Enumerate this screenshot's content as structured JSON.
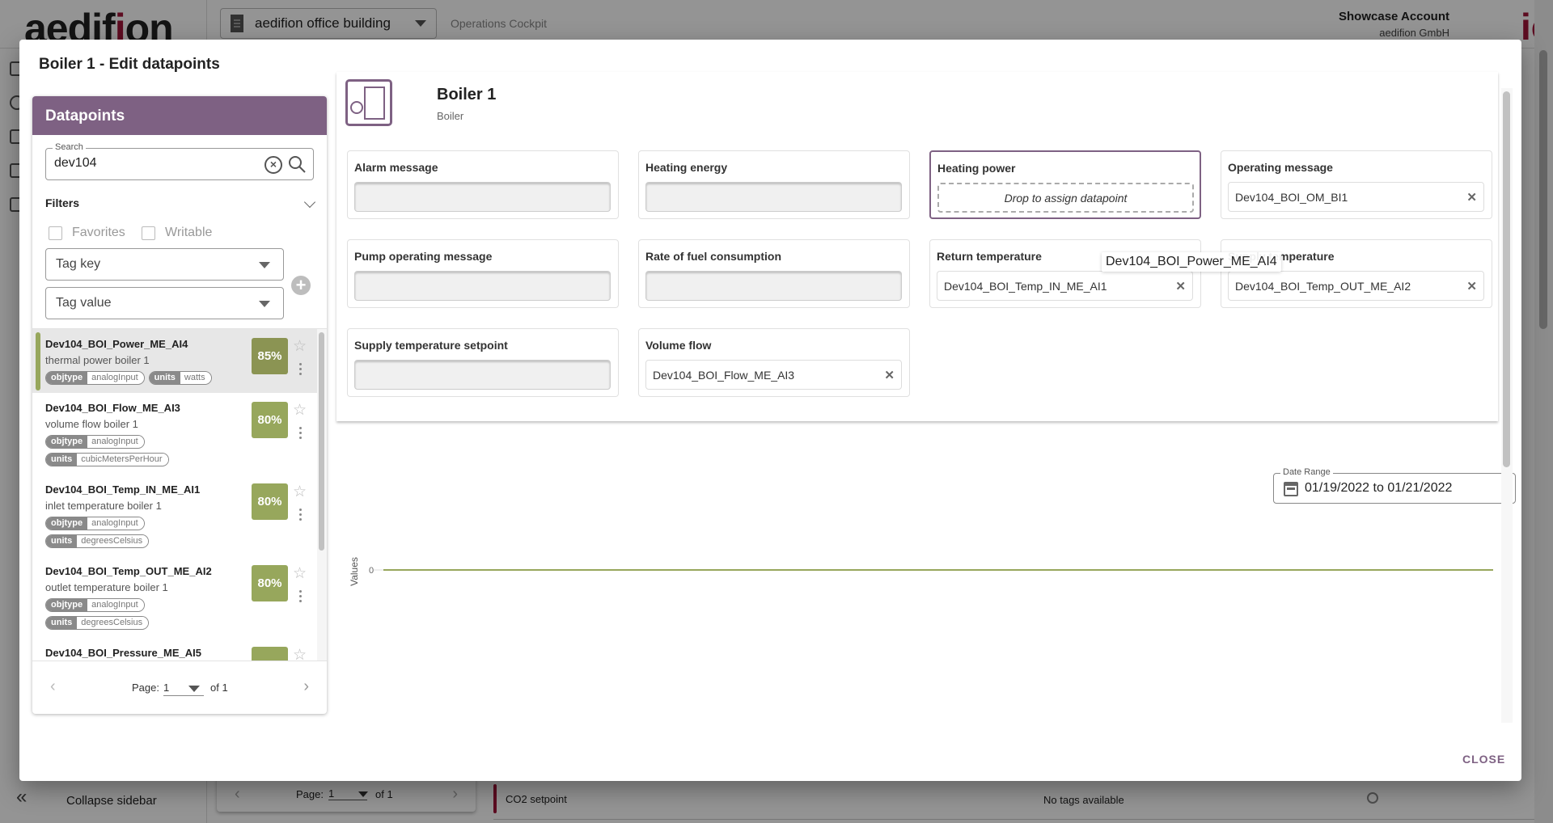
{
  "app": {
    "logo_text": "aedif",
    "logo_accent": "i",
    "logo_text_end": "on",
    "building": "aedifion office building",
    "nav_link": "Operations Cockpit",
    "account_name": "Showcase Account",
    "account_org": "aedifion GmbH",
    "io_logo": "io",
    "collapse_icon": "«",
    "collapse_label": "Collapse sidebar",
    "bg_pager": {
      "label": "Page:",
      "value": "1",
      "of": "of 1"
    },
    "bg_row": {
      "label": "CO2 setpoint",
      "tags": "No tags available"
    }
  },
  "dialog": {
    "title": "Boiler 1 - Edit datapoints",
    "close_label": "CLOSE",
    "datapoints_panel": {
      "header": "Datapoints",
      "search": {
        "legend": "Search",
        "value": "dev104"
      },
      "filters_label": "Filters",
      "favorites_label": "Favorites",
      "writable_label": "Writable",
      "tag_key_placeholder": "Tag key",
      "tag_value_placeholder": "Tag value",
      "items": [
        {
          "name": "Dev104_BOI_Power_ME_AI4",
          "desc": "thermal power boiler 1",
          "score": "85%",
          "selected": true,
          "tags": [
            {
              "k": "objtype",
              "v": "analogInput"
            },
            {
              "k": "units",
              "v": "watts"
            }
          ]
        },
        {
          "name": "Dev104_BOI_Flow_ME_AI3",
          "desc": "volume flow boiler 1",
          "score": "80%",
          "tags": [
            {
              "k": "objtype",
              "v": "analogInput"
            },
            {
              "k": "units",
              "v": "cubicMetersPerHour"
            }
          ]
        },
        {
          "name": "Dev104_BOI_Temp_IN_ME_AI1",
          "desc": "inlet temperature boiler 1",
          "score": "80%",
          "tags": [
            {
              "k": "objtype",
              "v": "analogInput"
            },
            {
              "k": "units",
              "v": "degreesCelsius"
            }
          ]
        },
        {
          "name": "Dev104_BOI_Temp_OUT_ME_AI2",
          "desc": "outlet temperature boiler 1",
          "score": "80%",
          "tags": [
            {
              "k": "objtype",
              "v": "analogInput"
            },
            {
              "k": "units",
              "v": "degreesCelsius"
            }
          ]
        },
        {
          "name": "Dev104_BOI_Pressure_ME_AI5",
          "desc": "",
          "score": "",
          "tags": []
        }
      ],
      "pager": {
        "prev": "‹",
        "label": "Page:",
        "value": "1",
        "of": "of 1",
        "next": "›"
      }
    },
    "component": {
      "title": "Boiler 1",
      "type": "Boiler",
      "slots": [
        {
          "label": "Alarm message",
          "state": "empty",
          "value": ""
        },
        {
          "label": "Heating energy",
          "state": "empty",
          "value": ""
        },
        {
          "label": "Heating power",
          "state": "drop",
          "value": "Drop to assign datapoint"
        },
        {
          "label": "Operating message",
          "state": "filled",
          "value": "Dev104_BOI_OM_BI1"
        },
        {
          "label": "Pump operating message",
          "state": "empty",
          "value": ""
        },
        {
          "label": "Rate of fuel consumption",
          "state": "empty",
          "value": ""
        },
        {
          "label": "Return temperature",
          "state": "filled",
          "value": "Dev104_BOI_Temp_IN_ME_AI1"
        },
        {
          "label": "Supply temperature",
          "state": "filled",
          "value": "Dev104_BOI_Temp_OUT_ME_AI2"
        },
        {
          "label": "Supply temperature setpoint",
          "state": "empty",
          "value": ""
        },
        {
          "label": "Volume flow",
          "state": "filled",
          "value": "Dev104_BOI_Flow_ME_AI3"
        }
      ],
      "drag_ghost": "Dev104_BOI_Power_ME_AI4"
    },
    "date_range": {
      "legend": "Date Range",
      "value": "01/19/2022 to 01/21/2022"
    }
  },
  "chart_data": {
    "type": "line",
    "title": "",
    "xlabel": "",
    "ylabel": "Values",
    "y_ticks": [
      "0"
    ],
    "series": [
      {
        "name": "Dev104_BOI_Power_ME_AI4",
        "color": "#97a75c",
        "values": [
          0,
          0
        ]
      }
    ],
    "ylim": [
      0,
      0
    ],
    "grid": false
  },
  "colors": {
    "brand_purple": "#7e6183",
    "score_green": "#97a75c",
    "brand_red": "#a0163a"
  }
}
